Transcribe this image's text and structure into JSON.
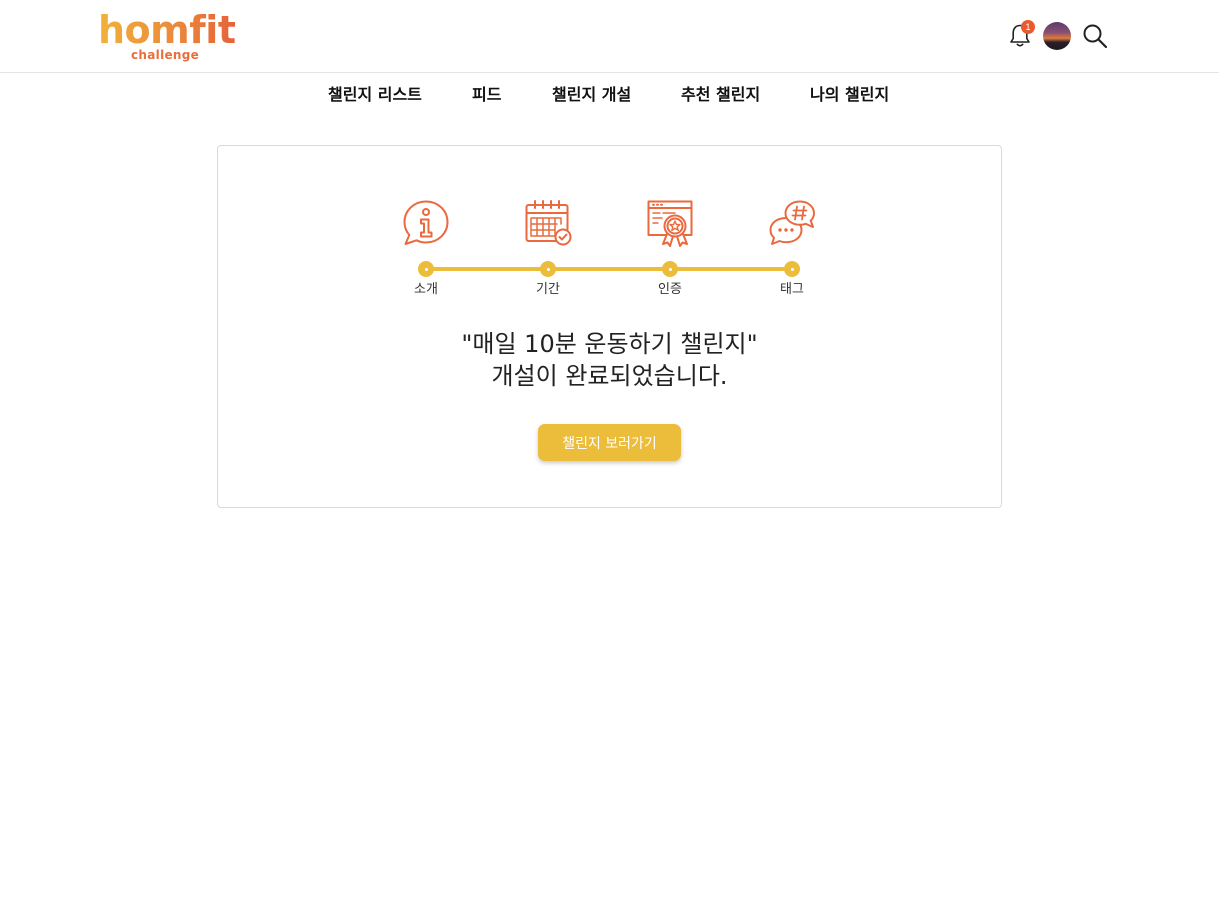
{
  "brand": {
    "name": "homfit",
    "sub": "challenge"
  },
  "header": {
    "notification_count": "1"
  },
  "nav": {
    "items": [
      {
        "label": "챌린지 리스트"
      },
      {
        "label": "피드"
      },
      {
        "label": "챌린지 개설"
      },
      {
        "label": "추천 챌린지"
      },
      {
        "label": "나의 챌린지"
      }
    ]
  },
  "progress": {
    "steps": [
      {
        "label": "소개",
        "icon": "info-chat-icon"
      },
      {
        "label": "기간",
        "icon": "calendar-check-icon"
      },
      {
        "label": "인증",
        "icon": "certificate-badge-icon"
      },
      {
        "label": "태그",
        "icon": "hashtag-chat-icon"
      }
    ]
  },
  "result": {
    "line1": "\"매일 10분 운동하기 챌린지\"",
    "line2": "개설이 완료되었습니다.",
    "button": "챌린지 보러가기"
  },
  "colors": {
    "accent": "#ebbd3a",
    "icon": "#e96a3e",
    "badge": "#ea5a2e"
  }
}
